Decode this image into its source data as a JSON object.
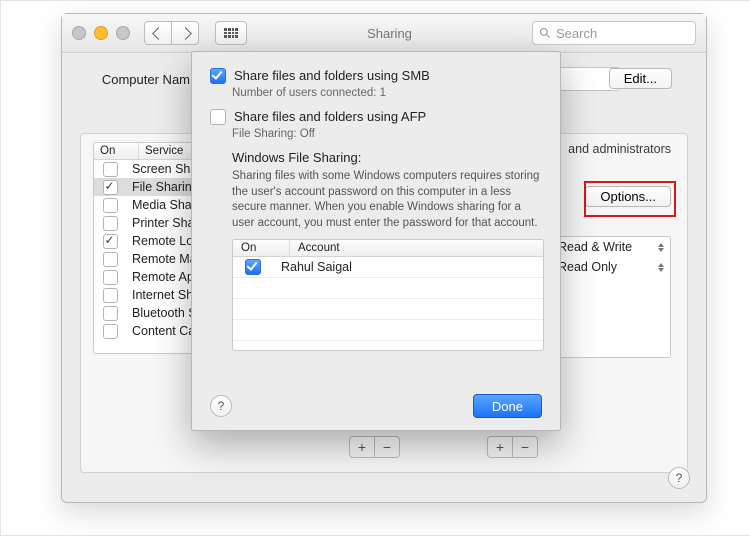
{
  "window": {
    "title": "Sharing",
    "search_placeholder": "Search"
  },
  "computer_name_label": "Computer Nam",
  "edit_button": "Edit...",
  "options_button": "Options...",
  "side_info": "and administrators",
  "service_table": {
    "headers": {
      "on": "On",
      "service": "Service"
    },
    "rows": [
      {
        "on": false,
        "label": "Screen Shar",
        "selected": false
      },
      {
        "on": true,
        "label": "File Sharing",
        "selected": true
      },
      {
        "on": false,
        "label": "Media Shar",
        "selected": false
      },
      {
        "on": false,
        "label": "Printer Sha",
        "selected": false
      },
      {
        "on": true,
        "label": "Remote Log",
        "selected": false
      },
      {
        "on": false,
        "label": "Remote Ma",
        "selected": false
      },
      {
        "on": false,
        "label": "Remote Ap",
        "selected": false
      },
      {
        "on": false,
        "label": "Internet Sh",
        "selected": false
      },
      {
        "on": false,
        "label": "Bluetooth S",
        "selected": false
      },
      {
        "on": false,
        "label": "Content Ca",
        "selected": false
      }
    ]
  },
  "permissions": [
    {
      "label": "Read & Write"
    },
    {
      "label": "Read Only"
    }
  ],
  "sheet": {
    "smb": {
      "checked": true,
      "label": "Share files and folders using SMB",
      "sub": "Number of users connected: 1"
    },
    "afp": {
      "checked": false,
      "label": "Share files and folders using AFP",
      "sub": "File Sharing: Off"
    },
    "wfs_title": "Windows File Sharing:",
    "wfs_desc": "Sharing files with some Windows computers requires storing the user's account password on this computer in a less secure manner. When you enable Windows sharing for a user account, you must enter the password for that account.",
    "account_table": {
      "headers": {
        "on": "On",
        "account": "Account"
      },
      "rows": [
        {
          "on": true,
          "account": "Rahul Saigal"
        }
      ]
    },
    "help_glyph": "?",
    "done": "Done"
  },
  "glyphs": {
    "plus": "+",
    "minus": "−",
    "help": "?"
  }
}
